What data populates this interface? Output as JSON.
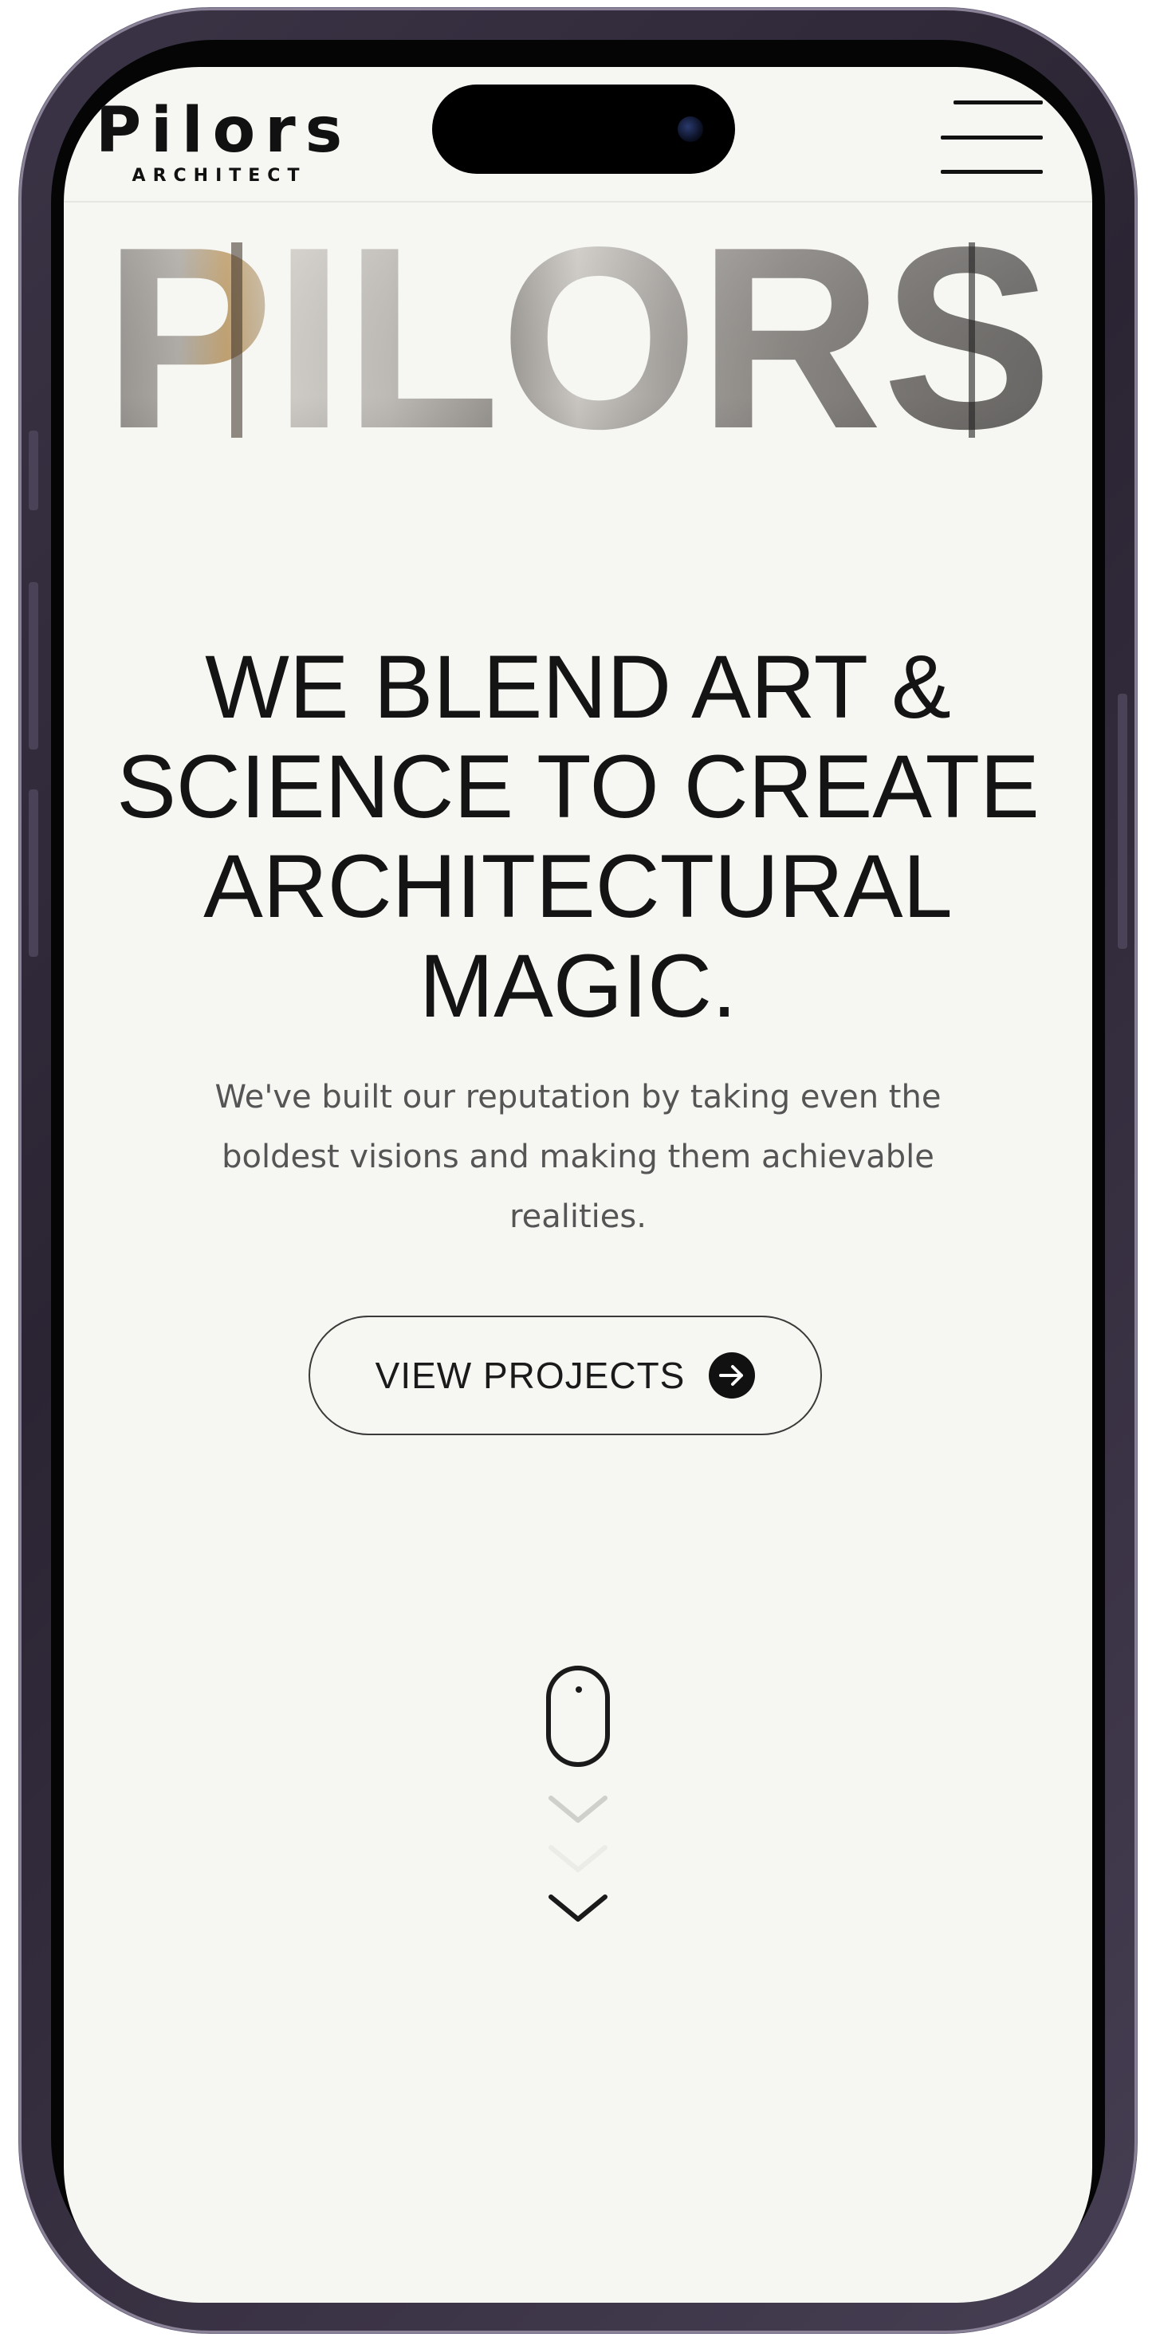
{
  "header": {
    "logo_main": "Pilors",
    "logo_sub": "ARCHITECT",
    "menu_icon": "hamburger-menu-icon"
  },
  "hero": {
    "word": "PILORS",
    "headline_lines": [
      "WE BLEND ART &",
      "SCIENCE TO CREATE",
      "ARCHITECTURAL",
      "MAGIC."
    ],
    "subtext_lines": [
      "We've built our reputation by taking even the",
      "boldest visions and making them achievable",
      "realities."
    ]
  },
  "cta": {
    "label": "VIEW PROJECTS",
    "icon": "arrow-right-circle-icon"
  },
  "scroll_indicator": {
    "icons": [
      "mouse-icon",
      "chevron-down-icon",
      "chevron-down-icon",
      "chevron-down-icon"
    ]
  },
  "colors": {
    "background": "#f6f6f2",
    "text": "#141414",
    "subtext": "#555555",
    "frame": "#2a2433"
  }
}
